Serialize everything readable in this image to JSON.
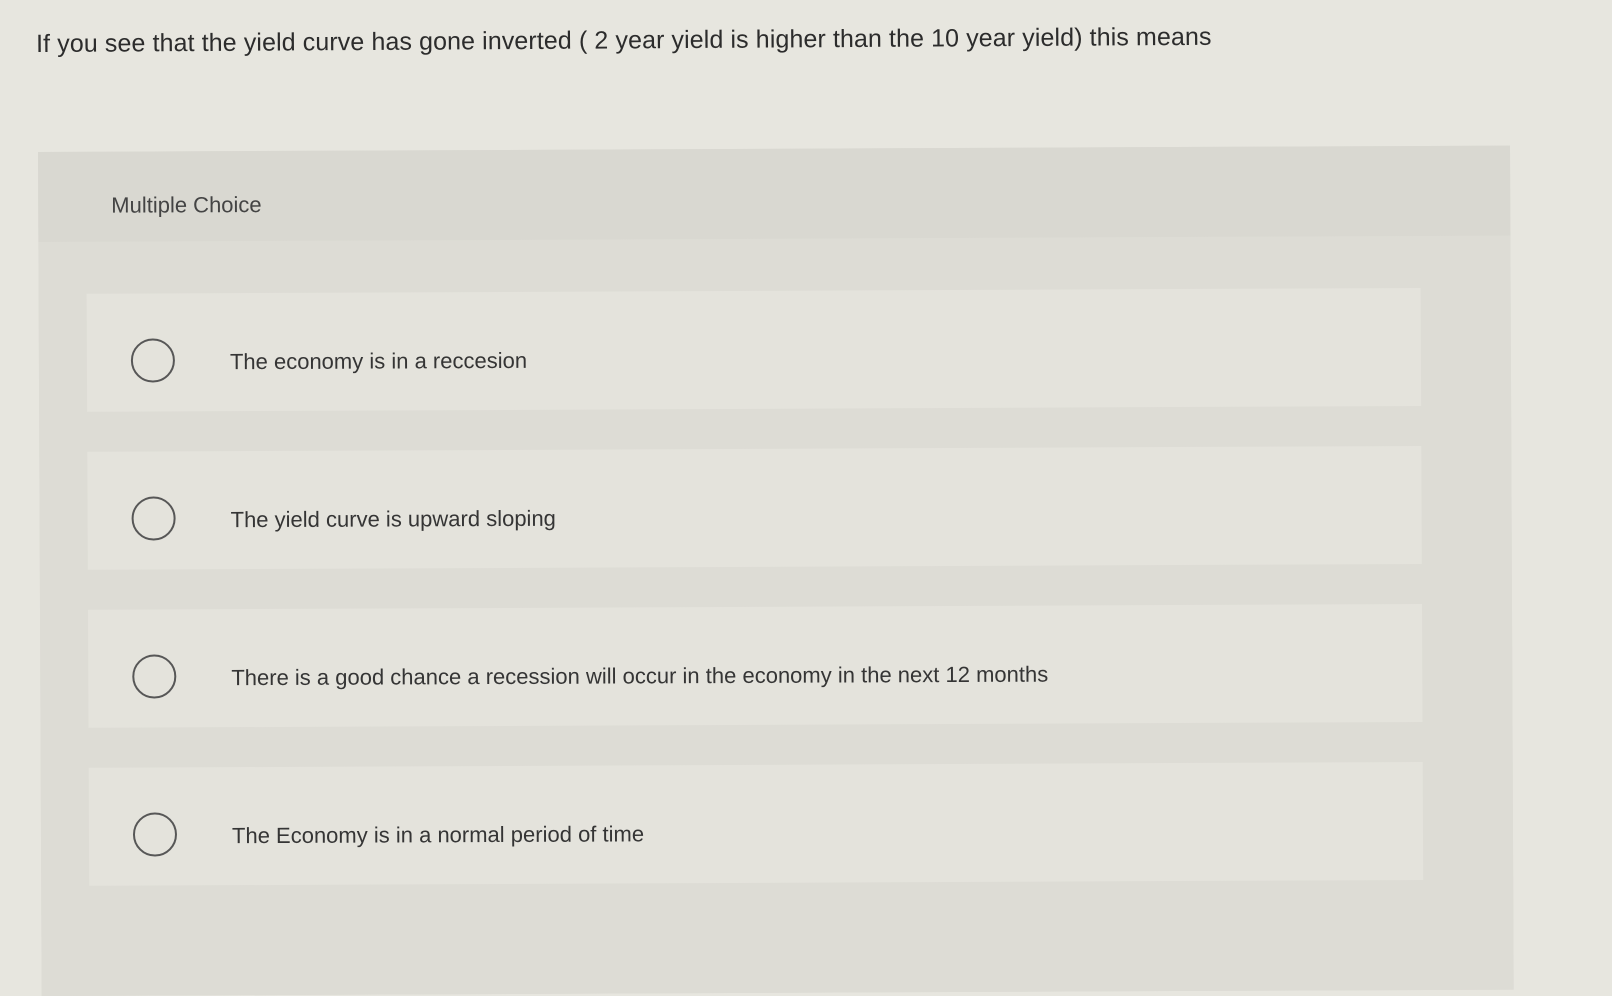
{
  "question": {
    "text": "If you see that the yield curve has gone inverted ( 2 year yield is higher than the 10 year yield) this means"
  },
  "mc": {
    "label": "Multiple Choice",
    "choices": [
      {
        "label": "The economy is in a reccesion",
        "selected": false
      },
      {
        "label": "The yield curve is upward sloping",
        "selected": false
      },
      {
        "label": "There is a good chance a recession will occur in the economy in the next 12 months",
        "selected": false
      },
      {
        "label": "The Economy is in a normal period of time",
        "selected": false
      }
    ]
  },
  "colors": {
    "page_background": "#e7e6df",
    "panel_background": "#dcdbd4",
    "choice_background": "#e4e3dc",
    "radio_border": "#575757",
    "text": "#2f2f2f"
  },
  "icons": {
    "radio": "radio-unchecked-icon"
  }
}
